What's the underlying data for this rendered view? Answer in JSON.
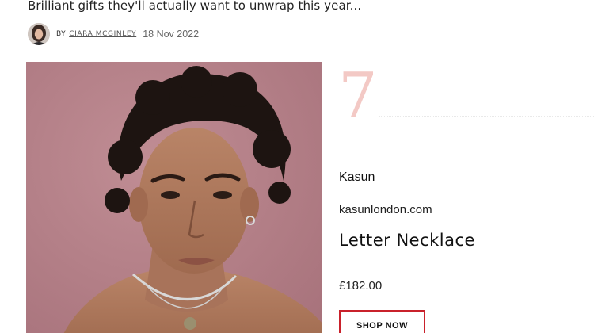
{
  "article": {
    "subtitle": "Brilliant gifts they'll actually want to unwrap this year...",
    "byline_prefix": "BY",
    "author": "CIARA MCGINLEY",
    "date": "18 Nov 2022"
  },
  "item": {
    "rank": "7",
    "brand": "Kasun",
    "website": "kasunlondon.com",
    "product_name": "Letter Necklace",
    "price": "£182.00",
    "cta_label": "SHOP NOW"
  },
  "colors": {
    "rank": "#f3c9c5",
    "cta_border": "#c9212b",
    "photo_background": "#b67f88"
  },
  "icons": {
    "avatar": "author-avatar-photo"
  }
}
